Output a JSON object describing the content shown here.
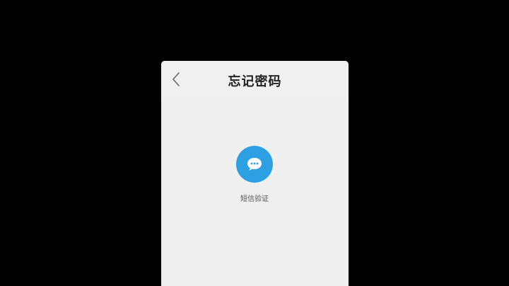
{
  "header": {
    "title": "忘记密码",
    "back_icon": "chevron-left-icon"
  },
  "options": [
    {
      "label": "短信验证",
      "icon": "chat-bubble-icon",
      "color": "#2d9fe3"
    }
  ],
  "colors": {
    "screen_background": "#efefef",
    "outer_background": "#000000",
    "accent": "#2d9fe3"
  }
}
